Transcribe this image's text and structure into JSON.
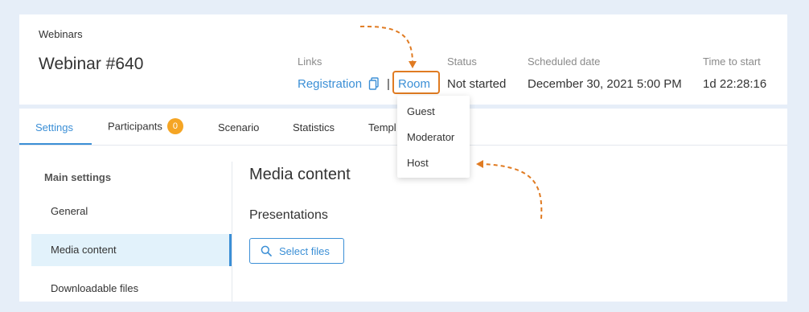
{
  "header": {
    "breadcrumb": "Webinars",
    "title": "Webinar #640",
    "links_label": "Links",
    "registration_link": "Registration",
    "separator": "|",
    "room_link": "Room",
    "status_label": "Status",
    "status_value": "Not started",
    "scheduled_label": "Scheduled date",
    "scheduled_value": "December 30, 2021 5:00 PM",
    "time_label": "Time to start",
    "time_value": "1d 22:28:16"
  },
  "tabs": [
    {
      "label": "Settings",
      "active": true
    },
    {
      "label": "Participants",
      "badge": "0"
    },
    {
      "label": "Scenario"
    },
    {
      "label": "Statistics"
    },
    {
      "label": "Templ"
    }
  ],
  "sidebar": {
    "heading": "Main settings",
    "items": [
      {
        "label": "General"
      },
      {
        "label": "Media content",
        "active": true
      },
      {
        "label": "Downloadable files"
      }
    ]
  },
  "content": {
    "title": "Media content",
    "subtitle": "Presentations",
    "select_button": "Select files"
  },
  "room_menu": {
    "items": [
      "Guest",
      "Moderator",
      "Host"
    ]
  },
  "colors": {
    "accent": "#3b8fd6",
    "highlight": "#e07b22",
    "badge": "#f5a524",
    "page_bg": "#e6eef8"
  }
}
